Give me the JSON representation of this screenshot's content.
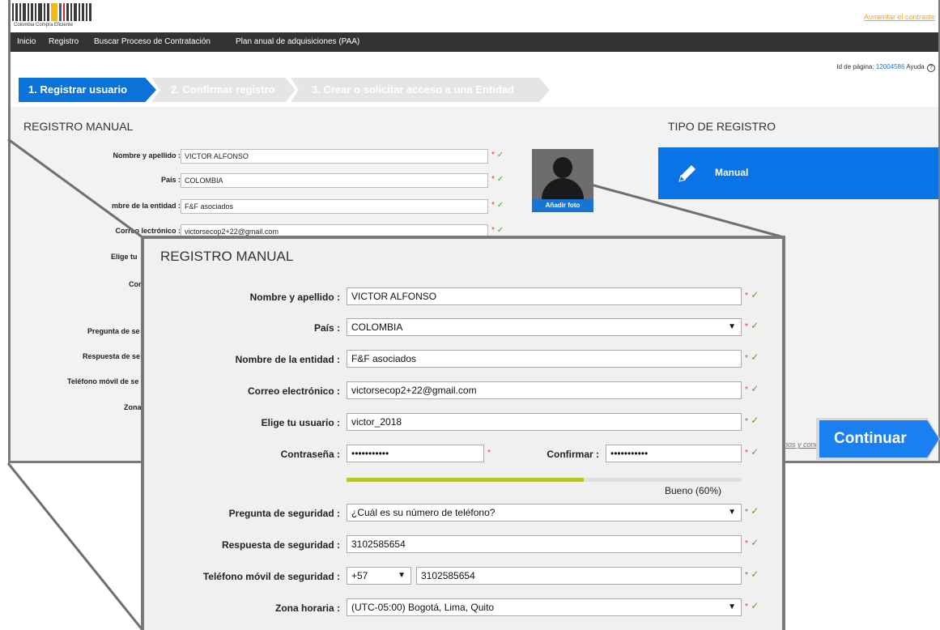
{
  "header": {
    "logo_text": "Colombia Compra Eficiente",
    "contrast_link": "Aumentar el contraste"
  },
  "nav": [
    "Inicio",
    "Registro",
    "Buscar Proceso de Contratación",
    "Plan anual de adquisiciones (PAA)"
  ],
  "page_id": {
    "label": "Id de página:",
    "value": "12004586",
    "help": "Ayuda",
    "help_icon": "?"
  },
  "steps": [
    "1. Registrar usuario",
    "2. Confirmar registro",
    "3. Crear o solicitar acceso a una Entidad"
  ],
  "form": {
    "title": "REGISTRO MANUAL",
    "name_label": "Nombre y apellido :",
    "name_value": "VICTOR ALFONSO",
    "country_label": "País :",
    "country_value": "COLOMBIA",
    "entity_label": "Nombre de la entidad :",
    "entity_value": "F&F asociados",
    "email_label": "Correo electrónico :",
    "email_value": "victorsecop2+22@gmail.com",
    "user_label": "Elige tu usuario :",
    "user_value": "victor_2018",
    "password_label": "Contraseña :",
    "password_value": "•••••••••••",
    "confirm_label": "Confirmar :",
    "confirm_value": "•••••••••••",
    "strength_text": "Bueno  (60%)",
    "strength_fraction": 0.6,
    "question_label": "Pregunta de seguridad :",
    "question_value": "¿Cuál es su número de teléfono?",
    "answer_label": "Respuesta de seguridad :",
    "answer_value": "3102585654",
    "phone_label": "Teléfono móvil de seguridad :",
    "phone_code": "+57",
    "phone_value": "3102585654",
    "timezone_label": "Zona horaria :",
    "timezone_value": "(UTC-05:00) Bogotá, Lima, Quito",
    "required_mark": "*",
    "valid_mark": "✓",
    "dropdown_arrow": "▼"
  },
  "background_form": {
    "label_user_partial": "Elige tu",
    "label_password_partial": "Con",
    "label_question_partial": "Pregunta de se",
    "label_answer_partial": "Respuesta de se",
    "label_phone_partial": "Teléfono móvil de se",
    "label_timezone_partial": "Zona",
    "entity_label_partial": "mbre de la entidad :",
    "email_label_partial": "Correo  lectrónico :",
    "email_value_partial": "victorsecop2+22@gmail.com"
  },
  "avatar": {
    "add_photo": "Añadir foto"
  },
  "registration_type": {
    "title": "TIPO DE REGISTRO",
    "manual": "Manual"
  },
  "terms_partial": "nos y cond",
  "continue_button": "Continuar",
  "colors": {
    "primary": "#0a73d9",
    "nav_bg": "#333333",
    "valid": "#5aa02c",
    "required": "#e53935",
    "strength": "#b8c32a"
  },
  "icons": {
    "pencil": "pencil-icon",
    "help": "help-circle-icon",
    "check": "check-icon",
    "dropdown": "chevron-down-icon"
  }
}
